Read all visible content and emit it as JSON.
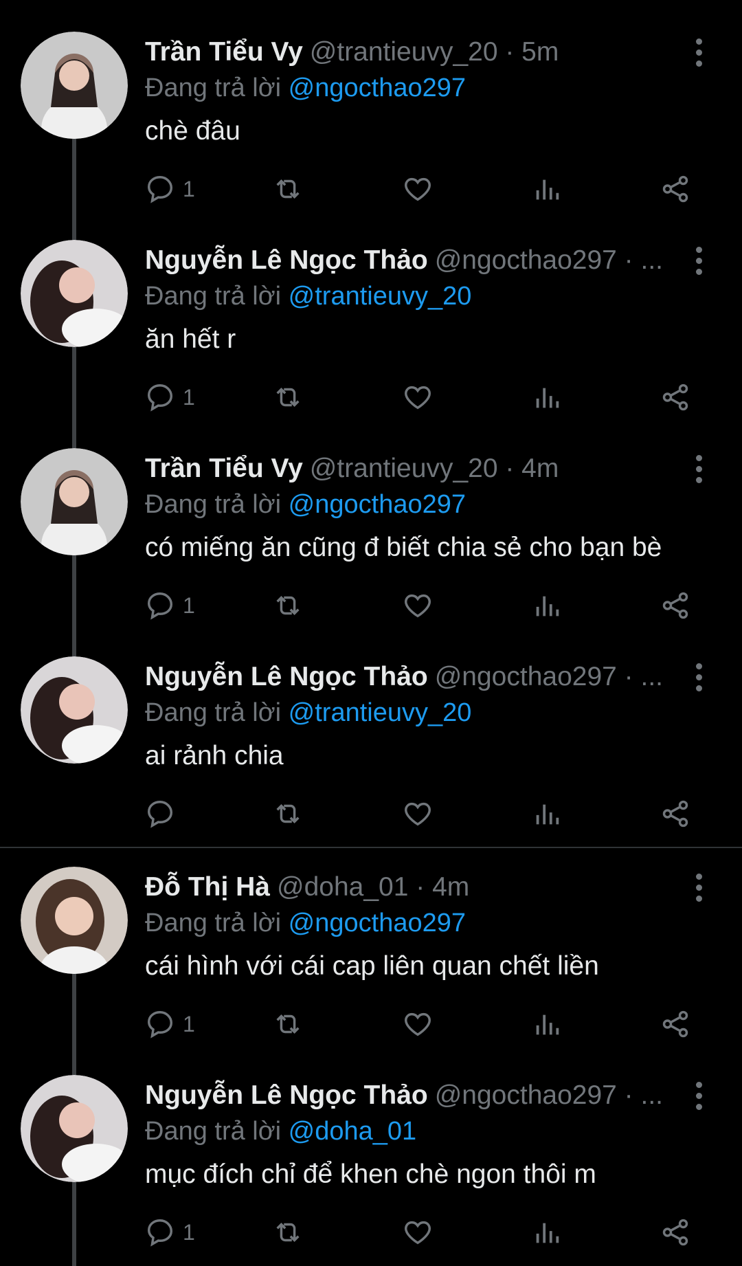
{
  "reply_prefix": "Đang trả lời",
  "icons": {
    "reply": "reply-icon",
    "retweet": "retweet-icon",
    "like": "heart-icon",
    "views": "views-icon",
    "share": "share-icon",
    "more": "more-vertical-icon"
  },
  "colors": {
    "background": "#000000",
    "mention": "#1d9bf0",
    "muted": "#71767b"
  },
  "tweets": [
    {
      "name": "Trần Tiểu Vy",
      "meta": "@trantieuvy_20 · 5m",
      "reply_to": "@ngocthao297",
      "text": "chè đâu",
      "reply_count": "1"
    },
    {
      "name": "Nguyễn Lê Ngọc Thảo",
      "meta": "@ngocthao297 · ...",
      "reply_to": "@trantieuvy_20",
      "text": "ăn hết r",
      "reply_count": "1"
    },
    {
      "name": "Trần Tiểu Vy",
      "meta": "@trantieuvy_20 · 4m",
      "reply_to": "@ngocthao297",
      "text": "có miếng ăn cũng đ biết chia sẻ cho bạn bè",
      "reply_count": "1"
    },
    {
      "name": "Nguyễn Lê Ngọc Thảo",
      "meta": "@ngocthao297 · ...",
      "reply_to": "@trantieuvy_20",
      "text": "ai rảnh chia",
      "reply_count": ""
    },
    {
      "name": "Đỗ Thị Hà",
      "meta": "@doha_01 · 4m",
      "reply_to": "@ngocthao297",
      "text": "cái hình với cái cap liên quan chết liền",
      "reply_count": "1"
    },
    {
      "name": "Nguyễn Lê Ngọc Thảo",
      "meta": "@ngocthao297 · ...",
      "reply_to": "@doha_01",
      "text": "mục đích chỉ để khen chè ngon thôi m",
      "reply_count": "1"
    }
  ]
}
